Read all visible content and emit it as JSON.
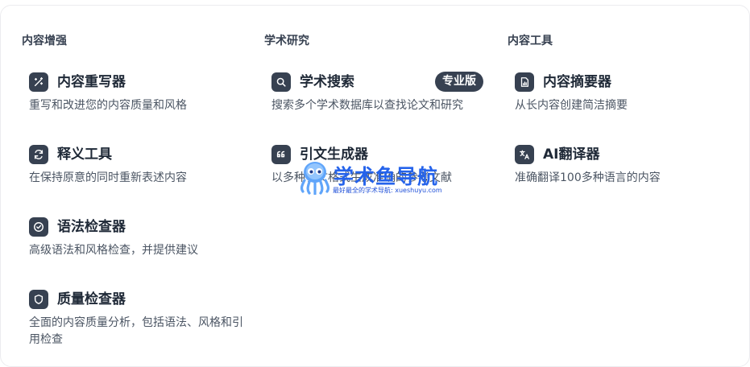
{
  "columns": [
    {
      "title": "内容增强",
      "items": [
        {
          "title": "内容重写器",
          "desc": "重写和改进您的内容质量和风格",
          "icon": "magic-wand-icon"
        },
        {
          "title": "释义工具",
          "desc": "在保持原意的同时重新表述内容",
          "icon": "refresh-icon"
        },
        {
          "title": "语法检查器",
          "desc": "高级语法和风格检查，并提供建议",
          "icon": "check-circle-icon"
        },
        {
          "title": "质量检查器",
          "desc": "全面的内容质量分析，包括语法、风格和引用检查",
          "icon": "shield-icon"
        }
      ]
    },
    {
      "title": "学术研究",
      "items": [
        {
          "title": "学术搜索",
          "desc": "搜索多个学术数据库以查找论文和研究",
          "icon": "search-icon",
          "badge": "专业版"
        },
        {
          "title": "引文生成器",
          "desc": "以多种引文格式生成准确的参考文献",
          "icon": "quote-icon"
        }
      ]
    },
    {
      "title": "内容工具",
      "items": [
        {
          "title": "内容摘要器",
          "desc": "从长内容创建简洁摘要",
          "icon": "document-chart-icon"
        },
        {
          "title": "AI翻译器",
          "desc": "准确翻译100多种语言的内容",
          "icon": "translate-icon"
        }
      ]
    }
  ],
  "watermark": {
    "title": "学术鱼导航",
    "subtitle": "最好最全的学术导航: xueshuyu.com"
  },
  "colors": {
    "icon_bg": "#374151",
    "watermark_blue": "#2563eb"
  }
}
